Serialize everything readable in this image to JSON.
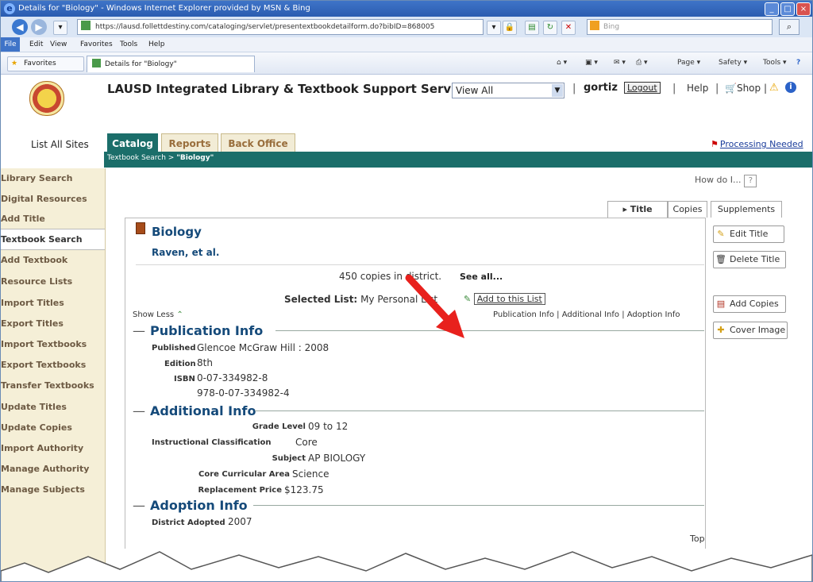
{
  "browser": {
    "title": "Details for \"Biology\" - Windows Internet Explorer provided by MSN & Bing",
    "url": "https://lausd.follettdestiny.com/cataloging/servlet/presentextbookdetailform.do?bibID=868005",
    "search_placeholder": "Bing",
    "menu": [
      "File",
      "Edit",
      "View",
      "Favorites",
      "Tools",
      "Help"
    ],
    "favorites_label": "Favorites",
    "tab_title": "Details for \"Biology\"",
    "commands": {
      "page": "Page ▾",
      "safety": "Safety ▾",
      "tools": "Tools ▾"
    }
  },
  "header": {
    "site_title": "LAUSD Integrated Library & Textbook Support Services",
    "view_select": "View All",
    "user": "gortiz",
    "logout": "Logout",
    "help": "Help",
    "shop": "Shop"
  },
  "nav": {
    "list_all_sites": "List All Sites",
    "tabs": [
      "Catalog",
      "Reports",
      "Back Office"
    ],
    "processing_needed": "Processing Needed",
    "breadcrumb_prefix": "Textbook Search > ",
    "breadcrumb_current": "\"Biology\""
  },
  "sidebar": {
    "items": [
      "Library Search",
      "Digital Resources",
      "Add Title",
      "Textbook Search",
      "Add Textbook",
      "Resource Lists",
      "Import Titles",
      "Export Titles",
      "Import Textbooks",
      "Export Textbooks",
      "Transfer Textbooks",
      "Update Titles",
      "Update Copies",
      "Import Authority",
      "Manage Authority",
      "Manage Subjects"
    ]
  },
  "main": {
    "how_do_i": "How do I...",
    "detail_tabs": [
      "Title Details",
      "Copies",
      "Supplements"
    ],
    "title": "Biology",
    "author": "Raven, et al.",
    "copies_text": "450 copies in district.",
    "see_all": "See all...",
    "selected_list_label": "Selected List:",
    "selected_list_value": "My Personal List",
    "add_to_list": "Add to this List",
    "show_less": "Show Less",
    "section_links": "Publication Info | Additional Info | Adoption Info",
    "publication": {
      "heading": "Publication Info",
      "published_label": "Published",
      "published_value": "Glencoe McGraw Hill : 2008",
      "edition_label": "Edition",
      "edition_value": "8th",
      "isbn_label": "ISBN",
      "isbn_1": "0-07-334982-8",
      "isbn_2": "978-0-07-334982-4"
    },
    "additional": {
      "heading": "Additional Info",
      "grade_label": "Grade Level",
      "grade_value": "09 to 12",
      "instr_label": "Instructional Classification",
      "instr_value": "Core",
      "subject_label": "Subject",
      "subject_value": "AP BIOLOGY",
      "core_label": "Core Curricular Area",
      "core_value": "Science",
      "price_label": "Replacement Price",
      "price_value": "$123.75"
    },
    "adoption": {
      "heading": "Adoption Info",
      "district_label": "District Adopted",
      "district_value": "2007"
    },
    "top": "Top"
  },
  "actions": [
    "Edit Title",
    "Delete Title",
    "Add Copies",
    "Cover Image"
  ],
  "colors": {
    "teal": "#1b6e6a",
    "sidebar": "#f5efd7",
    "title_blue": "#154a7a",
    "arrow": "#e8211d"
  }
}
